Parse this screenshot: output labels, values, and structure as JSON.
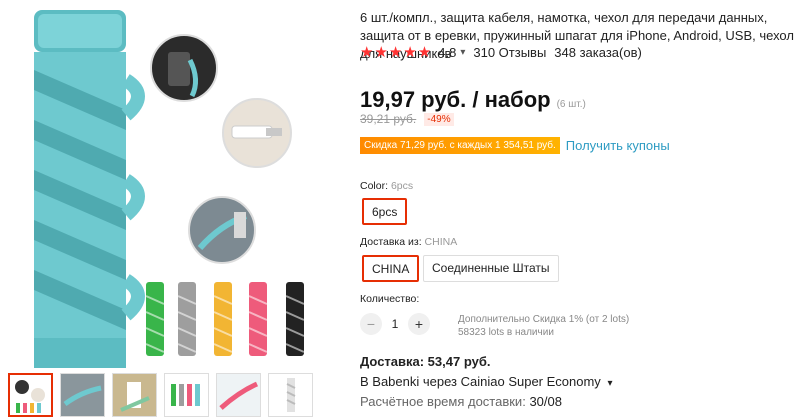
{
  "product": {
    "title": "6 шт./компл., защита кабеля, намотка, чехол для передачи данных, защита от в еревки, пружинный шпагат для iPhone, Android, USB, чехол для наушников",
    "rating_stars": "★★★★★",
    "rating": "4.8",
    "reviews": "310 Отзывы",
    "orders": "348 заказа(ов)",
    "price": "19,97 руб. / набор",
    "price_unit": "(6 шт.)",
    "old_price": "39,21 руб.",
    "discount": "-49%",
    "coupon_tag": "Скидка 71,29 руб. с каждых 1 354,51 руб.",
    "coupon_link": "Получить купоны"
  },
  "color": {
    "label": "Color:",
    "value": "6pcs",
    "option": "6pcs"
  },
  "shipping_from": {
    "label": "Доставка из:",
    "value": "CHINA",
    "options": [
      "CHINA",
      "Соединенные Штаты"
    ]
  },
  "quantity": {
    "label": "Количество:",
    "value": "1",
    "minus": "−",
    "plus": "+",
    "note_discount": "Дополнительно Скидка 1% (от 2 lots)",
    "note_stock": "58323 lots в наличии"
  },
  "delivery": {
    "price": "Доставка: 53,47 руб.",
    "via": "В Babenki через Cainiao Super Economy",
    "time_label": "Расчётное время доставки:",
    "time_value": "30/08"
  },
  "icons": {
    "rating_chevron": "chevron-down-icon",
    "via_chevron": "chevron-down-icon"
  },
  "colors": {
    "accent": "#e62e04",
    "stars": "#ff3333",
    "link": "#2e9cc3",
    "cable_protector": "#6ec9cf"
  }
}
